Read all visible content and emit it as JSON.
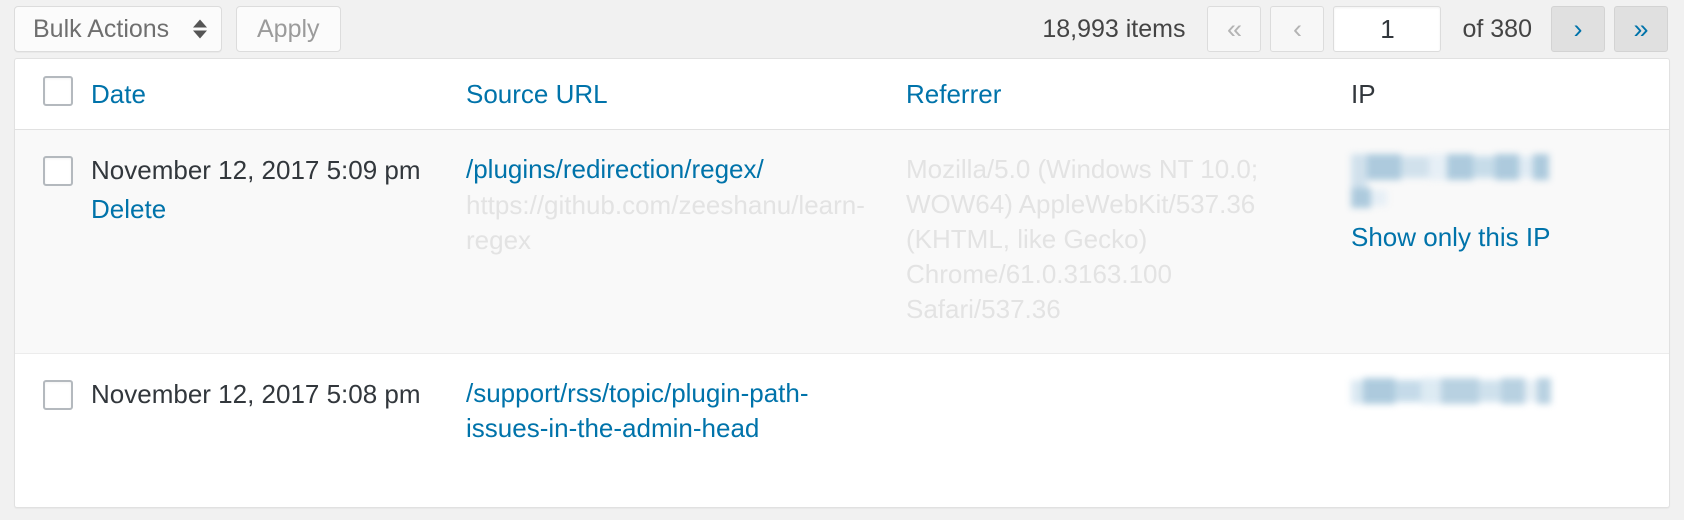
{
  "toolbar": {
    "bulk_actions_label": "Bulk Actions",
    "apply_label": "Apply",
    "items_count": "18,993 items",
    "pager": {
      "first_label": "«",
      "prev_label": "‹",
      "current_page": "1",
      "of_total": "of 380",
      "next_label": "›",
      "last_label": "»"
    }
  },
  "table": {
    "columns": {
      "date": "Date",
      "source_url": "Source URL",
      "referrer": "Referrer",
      "ip": "IP"
    },
    "rows": [
      {
        "date": "November 12, 2017 5:09 pm",
        "delete_label": "Delete",
        "source_url": "/plugins/redirection/regex/",
        "source_sub": "https://github.com/zeeshanu/learn-regex",
        "referrer": "Mozilla/5.0 (Windows NT 10.0; WOW64) AppleWebKit/537.36 (KHTML, like Gecko) Chrome/61.0.3163.100 Safari/537.36",
        "ip_redacted": true,
        "ip_action_label": "Show only this IP"
      },
      {
        "date": "November 12, 2017 5:08 pm",
        "delete_label": "",
        "source_url": "/support/rss/topic/plugin-path-issues-in-the-admin-head",
        "source_sub": "",
        "referrer": "",
        "ip_redacted": true,
        "ip_action_label": ""
      }
    ]
  },
  "colors": {
    "link": "#0073aa",
    "text": "#32373c",
    "muted": "#e3e3e3",
    "chrome_bg": "#f1f1f1",
    "row_alt_bg": "#f9f9f9",
    "border": "#e1e1e1"
  }
}
